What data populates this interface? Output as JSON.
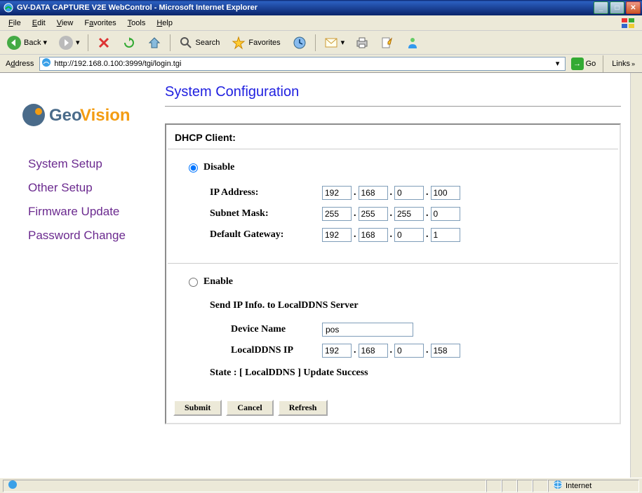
{
  "window": {
    "title": "GV-DATA CAPTURE V2E WebControl - Microsoft Internet Explorer"
  },
  "menu": {
    "file": "File",
    "edit": "Edit",
    "view": "View",
    "favorites": "Favorites",
    "tools": "Tools",
    "help": "Help"
  },
  "toolbar": {
    "back": "Back",
    "search": "Search",
    "favorites": "Favorites"
  },
  "address": {
    "label": "Address",
    "url": "http://192.168.0.100:3999/tgi/login.tgi",
    "go": "Go",
    "links": "Links"
  },
  "brand": {
    "name": "GeoVision"
  },
  "nav": {
    "system_setup": "System Setup",
    "other_setup": "Other Setup",
    "firmware_update": "Firmware Update",
    "password_change": "Password Change"
  },
  "page": {
    "title": "System Configuration"
  },
  "dhcp": {
    "header": "DHCP Client:",
    "disable_label": "Disable",
    "enable_label": "Enable",
    "ip_label": "IP Address:",
    "ip": {
      "a": "192",
      "b": "168",
      "c": "0",
      "d": "100"
    },
    "mask_label": "Subnet Mask:",
    "mask": {
      "a": "255",
      "b": "255",
      "c": "255",
      "d": "0"
    },
    "gw_label": "Default Gateway:",
    "gw": {
      "a": "192",
      "b": "168",
      "c": "0",
      "d": "1"
    }
  },
  "ddns": {
    "sub_label": "Send IP Info. to LocalDDNS Server",
    "device_label": "Device Name",
    "device_value": "pos",
    "ip_label": "LocalDDNS IP",
    "ip": {
      "a": "192",
      "b": "168",
      "c": "0",
      "d": "158"
    },
    "state": "State :   [ LocalDDNS ] Update Success"
  },
  "buttons": {
    "submit": "Submit",
    "cancel": "Cancel",
    "refresh": "Refresh"
  },
  "status": {
    "zone": "Internet"
  }
}
